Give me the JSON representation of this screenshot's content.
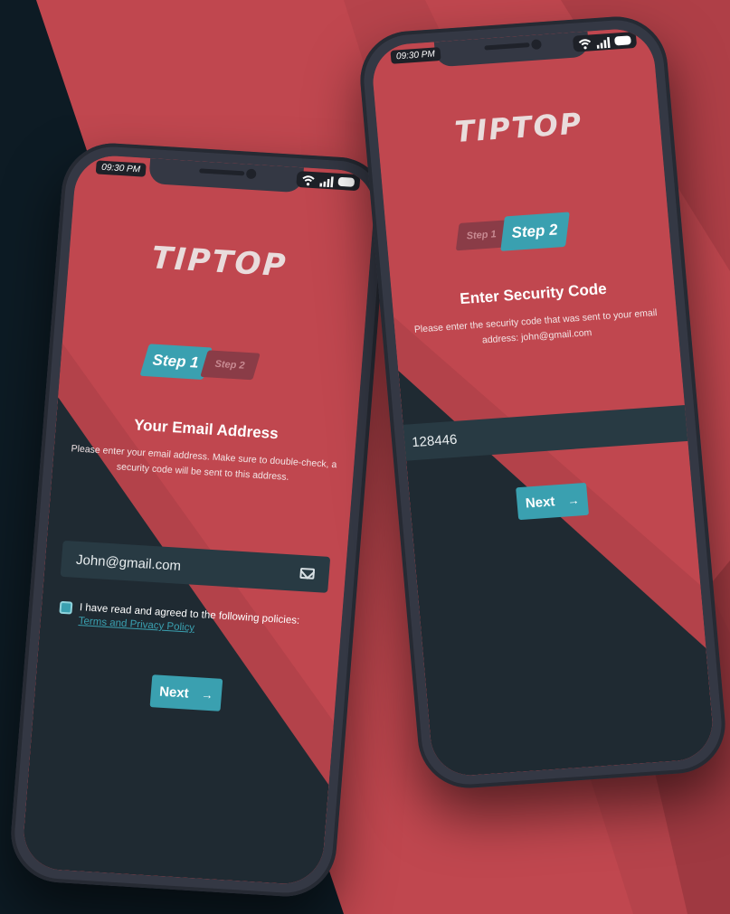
{
  "colors": {
    "red": "#c0474f",
    "dark": "#1f2a32",
    "teal": "#3aa0b0",
    "phone_body": "#343844"
  },
  "left_phone": {
    "status_time": "09:30 PM",
    "logo": "TIPTOP",
    "steps": {
      "active": "Step 1",
      "inactive": "Step 2"
    },
    "title": "Your Email Address",
    "description": "Please enter your email address. Make sure to double-check, a security code will be sent to this address.",
    "email_value": "John@gmail.com",
    "agree_text": "I have read and agreed to the following policies:",
    "agree_link": "Terms and Privacy Policy",
    "next_label": "Next",
    "icons": {
      "field": "mail-icon",
      "next": "arrow-right-icon"
    }
  },
  "right_phone": {
    "status_time": "09:30 PM",
    "logo": "TIPTOP",
    "steps": {
      "inactive": "Step 1",
      "active": "Step 2"
    },
    "title": "Enter Security Code",
    "description": "Please enter the security code that was sent to your email address: john@gmail.com",
    "code_value": "128446",
    "next_label": "Next",
    "icons": {
      "next": "arrow-right-icon"
    }
  }
}
